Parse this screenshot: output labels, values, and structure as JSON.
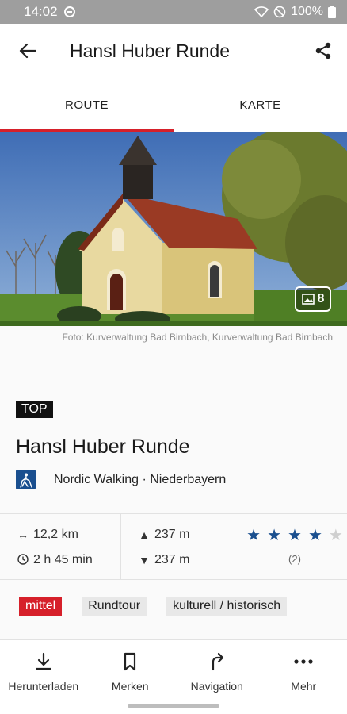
{
  "status_bar": {
    "time": "14:02",
    "battery": "100%"
  },
  "header": {
    "title": "Hansl Huber Runde"
  },
  "tabs": [
    {
      "label": "ROUTE"
    },
    {
      "label": "KARTE"
    }
  ],
  "hero": {
    "photo_count": "8",
    "credit": "Foto: Kurverwaltung Bad Birnbach, Kurverwaltung Bad Birnbach"
  },
  "route": {
    "badge": "TOP",
    "title": "Hansl Huber Runde",
    "activity": "Nordic Walking · Niederbayern"
  },
  "stats": {
    "distance": "12,2 km",
    "duration": "2 h 45 min",
    "ascent": "237 m",
    "descent": "237 m",
    "rating": 4,
    "rating_max": 5,
    "rating_count": "(2)"
  },
  "tags": [
    {
      "label": "mittel"
    },
    {
      "label": "Rundtour"
    },
    {
      "label": "kulturell / historisch"
    }
  ],
  "bottom_nav": [
    {
      "label": "Herunterladen"
    },
    {
      "label": "Merken"
    },
    {
      "label": "Navigation"
    },
    {
      "label": "Mehr"
    }
  ],
  "colors": {
    "accent": "#d6202a",
    "brand_blue": "#1a4f8f"
  }
}
